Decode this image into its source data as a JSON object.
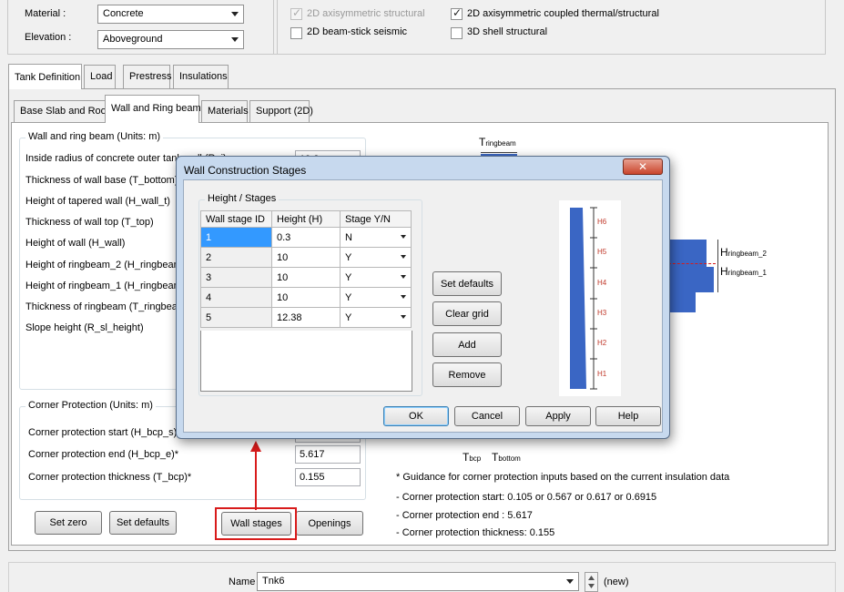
{
  "header": {
    "material_label": "Material :",
    "material_value": "Concrete",
    "elevation_label": "Elevation :",
    "elevation_value": "Aboveground",
    "analysis_options": [
      {
        "label": "2D axisymmetric structural",
        "checked": true,
        "disabled": true
      },
      {
        "label": "2D axisymmetric coupled thermal/structural",
        "checked": true,
        "disabled": false
      },
      {
        "label": "2D beam-stick seismic",
        "checked": false,
        "disabled": false
      },
      {
        "label": "3D shell structural",
        "checked": false,
        "disabled": false
      }
    ]
  },
  "main_tabs": [
    "Tank Definition",
    "Load",
    "Prestress",
    "Insulations"
  ],
  "sub_tabs": [
    "Base Slab and Roof",
    "Wall and Ring beam",
    "Materials",
    "Support (2D)"
  ],
  "wall_group": {
    "title": "Wall and ring beam (Units: m)",
    "fields": [
      "Inside radius of concrete outer tank wall (R_i)",
      "Thickness of wall base (T_bottom)",
      "Height of tapered wall (H_wall_t)",
      "Thickness of wall top (T_top)",
      "Height of wall (H_wall)",
      "Height of ringbeam_2 (H_ringbeam_2)",
      "Height of ringbeam_1 (H_ringbeam_1)",
      "Thickness of ringbeam (T_ringbeam)",
      "Slope height (R_sl_height)"
    ],
    "first_value": "19.2"
  },
  "corner_group": {
    "title": "Corner Protection (Units: m)",
    "fields": [
      {
        "label": "Corner protection start (H_bcp_s)*",
        "value": "0.6915"
      },
      {
        "label": "Corner protection end (H_bcp_e)*",
        "value": "5.617"
      },
      {
        "label": "Corner protection thickness (T_bcp)*",
        "value": "0.155"
      }
    ]
  },
  "bottom_buttons": {
    "set_zero": "Set zero",
    "set_defaults": "Set defaults",
    "wall_stages": "Wall stages",
    "openings": "Openings"
  },
  "guidance": [
    "* Guidance for corner protection inputs based on the current insulation data",
    "- Corner protection start: 0.105 or 0.567 or 0.617 or 0.6915",
    "- Corner protection end : 5.617",
    "- Corner protection thickness: 0.155"
  ],
  "diagram": {
    "t_ringbeam": "T",
    "t_ringbeam_sub": "ringbeam",
    "h_ringbeam_2": "H",
    "h_ringbeam_2_sub": "ringbeam_2",
    "h_ringbeam_1": "H",
    "h_ringbeam_1_sub": "ringbeam_1",
    "t_bcp": "T",
    "t_bcp_sub": "bcp",
    "t_bottom": "T",
    "t_bottom_sub": "bottom"
  },
  "name_bar": {
    "label": "Name",
    "value": "Tnk6",
    "status": "(new)"
  },
  "dialog": {
    "title": "Wall Construction Stages",
    "group_title": "Height / Stages",
    "columns": [
      "Wall stage ID",
      "Height (H)",
      "Stage Y/N"
    ],
    "rows": [
      {
        "id": "1",
        "height": "0.3",
        "stage": "N"
      },
      {
        "id": "2",
        "height": "10",
        "stage": "Y"
      },
      {
        "id": "3",
        "height": "10",
        "stage": "Y"
      },
      {
        "id": "4",
        "height": "10",
        "stage": "Y"
      },
      {
        "id": "5",
        "height": "12.38",
        "stage": "Y"
      }
    ],
    "side_buttons": [
      "Set defaults",
      "Clear grid",
      "Add",
      "Remove"
    ],
    "stage_labels": [
      "H6",
      "H5",
      "H4",
      "H3",
      "H2",
      "H1"
    ],
    "ok": "OK",
    "cancel": "Cancel",
    "apply": "Apply",
    "help": "Help",
    "close_glyph": "✕"
  },
  "colors": {
    "highlight": "#d81b1b",
    "wall_fill": "#3a66c4",
    "selection": "#3399ff"
  }
}
